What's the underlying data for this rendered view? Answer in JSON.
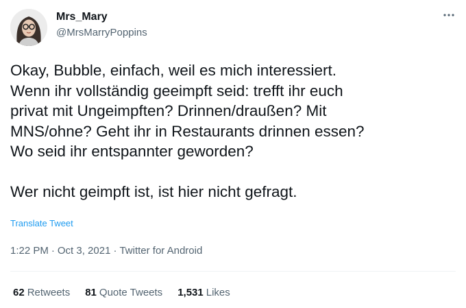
{
  "author": {
    "name": "Mrs_Mary",
    "handle": "@MrsMarryPoppins"
  },
  "tweet": {
    "lines": [
      "Okay, Bubble, einfach, weil es mich interessiert.",
      "Wenn ihr vollständig geeimpft seid: trefft ihr euch",
      "privat mit Ungeimpften? Drinnen/draußen? Mit",
      "MNS/ohne?  Geht ihr in Restaurants drinnen essen?",
      "Wo seid ihr entspannter geworden?",
      "Wer nicht geimpft ist, ist hier nicht gefragt."
    ],
    "translate_label": "Translate Tweet"
  },
  "meta": {
    "time": "1:22 PM",
    "separator": "·",
    "date": "Oct 3, 2021",
    "source": "Twitter for Android"
  },
  "stats": {
    "retweets_count": "62",
    "retweets_label": "Retweets",
    "quotes_count": "81",
    "quotes_label": "Quote Tweets",
    "likes_count": "1,531",
    "likes_label": "Likes"
  },
  "icons": {
    "more": "more-dots-icon",
    "avatar": "avatar-photo"
  }
}
